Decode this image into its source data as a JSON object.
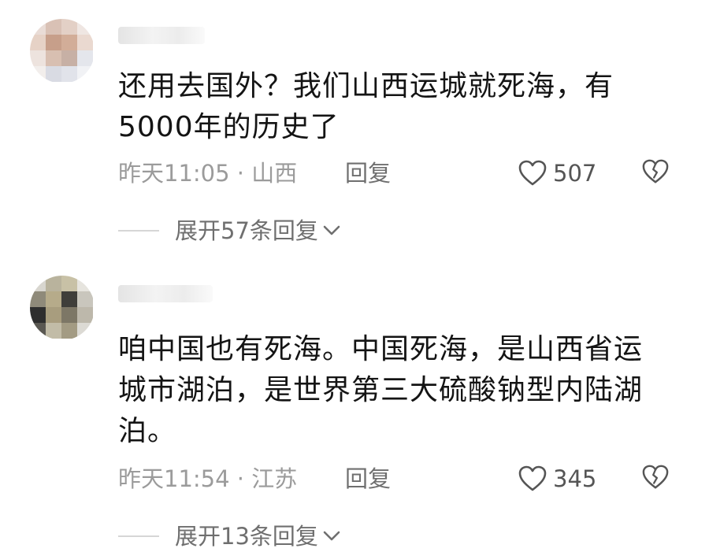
{
  "comments": [
    {
      "text": "还用去国外？我们山西运城就死海，有5000年的历史了",
      "time_location": "昨天11:05 · 山西",
      "reply_label": "回复",
      "likes": "507",
      "expand_label": "展开57条回复"
    },
    {
      "text": "咱中国也有死海。中国死海，是山西省运城市湖泊，是世界第三大硫酸钠型内陆湖泊。",
      "time_location": "昨天11:54 · 江苏",
      "reply_label": "回复",
      "likes": "345",
      "expand_label": "展开13条回复"
    }
  ],
  "icons": {
    "like": "heart-outline-icon",
    "dislike": "broken-heart-icon",
    "expand": "chevron-down-icon"
  },
  "colors": {
    "text": "#141414",
    "meta": "#9b9b9b",
    "secondary": "#6f6f6f"
  }
}
